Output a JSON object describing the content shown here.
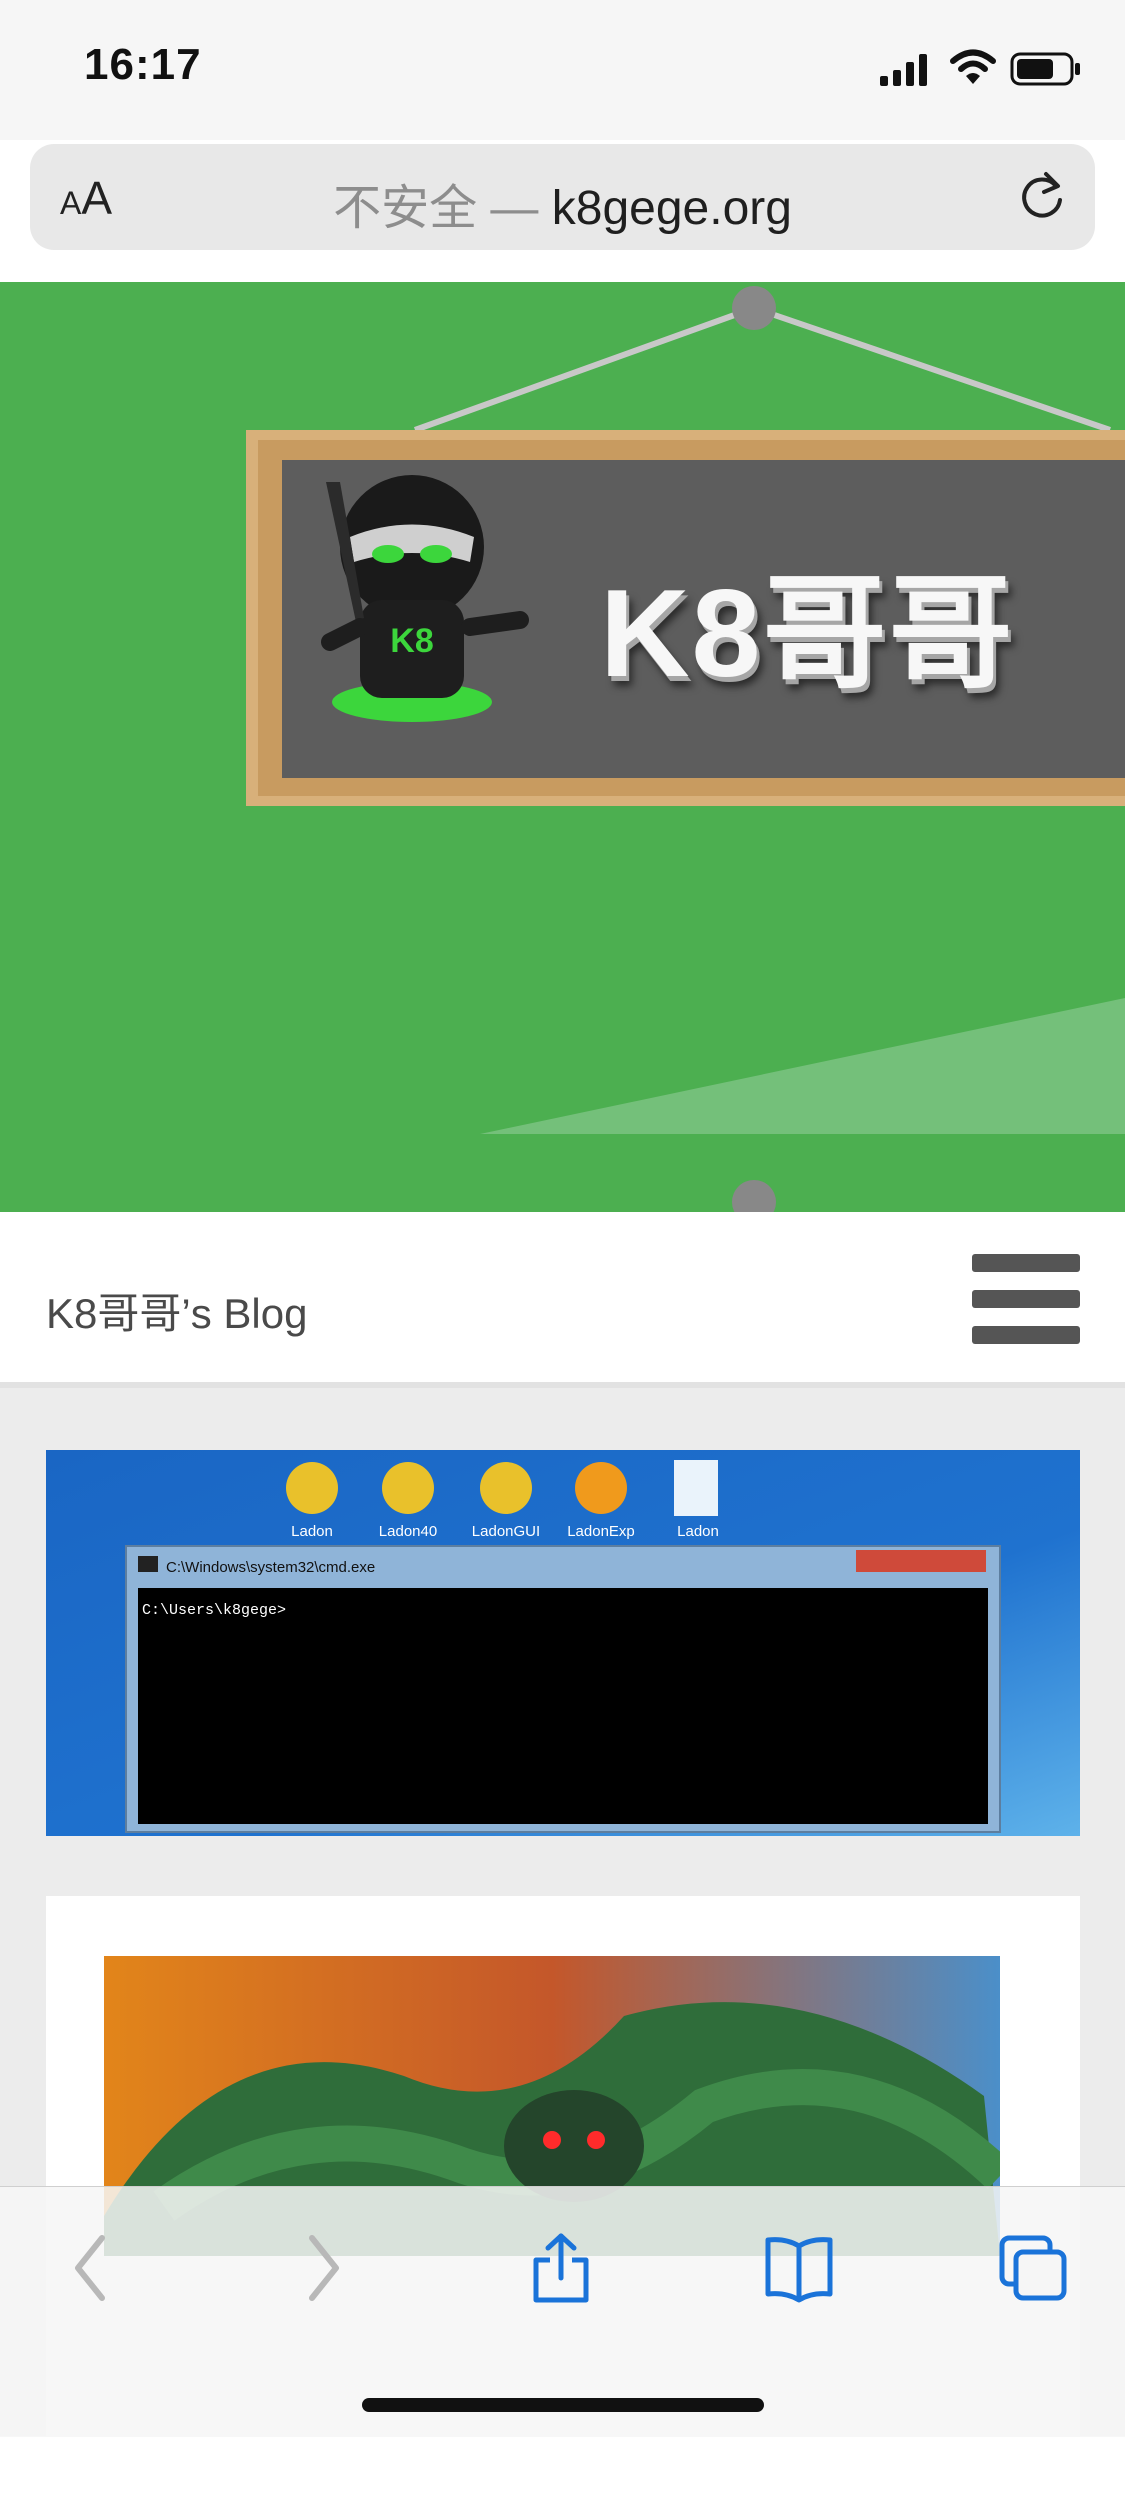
{
  "status_bar": {
    "time": "16:17"
  },
  "browser": {
    "text_size_button": {
      "small": "A",
      "large": "A"
    },
    "url": {
      "security_label": "不安全 —",
      "domain": "k8gege.org"
    }
  },
  "hero": {
    "board_title": "K8哥哥",
    "mascot_badge": "K8"
  },
  "site_header": {
    "site_name": "K8哥哥’s Blog"
  },
  "post_preview": {
    "desktop_icons": [
      "Ladon",
      "Ladon40",
      "LadonGUI",
      "LadonExp",
      "Ladon"
    ],
    "cmd_window_title": "C:\\Windows\\system32\\cmd.exe",
    "cmd_prompt": "C:\\Users\\k8gege>"
  },
  "colors": {
    "hero_green": "#4caf50",
    "link_blue": "#1a73d9",
    "board_gray": "#5d5d5d",
    "frame_wood": "#d8b07a"
  }
}
